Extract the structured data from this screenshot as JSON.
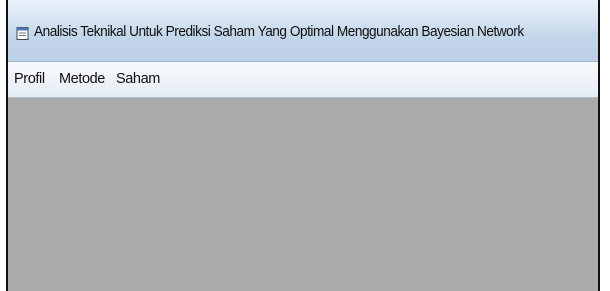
{
  "window": {
    "title": "Analisis Teknikal Untuk Prediksi Saham Yang Optimal Menggunakan Bayesian Network",
    "icon": "app-window-icon"
  },
  "menubar": {
    "items": [
      {
        "label": "Profil"
      },
      {
        "label": "Metode"
      },
      {
        "label": "Saham"
      }
    ]
  },
  "colors": {
    "titlebar": "#c4d6ea",
    "menubar": "#eef2f8",
    "workspace": "#aaaaaa",
    "frame_border": "#111111"
  }
}
